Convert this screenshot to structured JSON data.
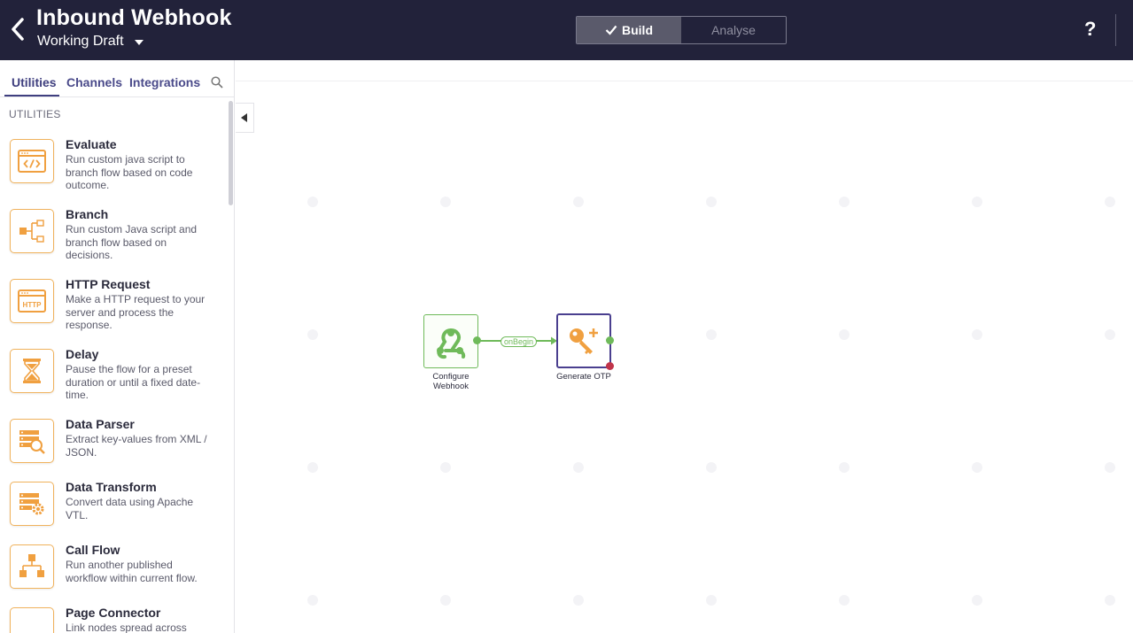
{
  "header": {
    "title": "Inbound Webhook",
    "draft_label": "Working Draft",
    "mode_build": "Build",
    "mode_analyse": "Analyse",
    "help": "?"
  },
  "sidebar": {
    "tabs": [
      "Utilities",
      "Channels",
      "Integrations"
    ],
    "active_tab": "Utilities",
    "section_label": "UTILITIES",
    "items": [
      {
        "name": "Evaluate",
        "desc": "Run custom java script to branch flow based on code outcome.",
        "icon": "code-window-icon"
      },
      {
        "name": "Branch",
        "desc": "Run custom Java script and branch flow based on decisions.",
        "icon": "branch-icon"
      },
      {
        "name": "HTTP Request",
        "desc": "Make a HTTP request to your server and process the response.",
        "icon": "http-window-icon"
      },
      {
        "name": "Delay",
        "desc": "Pause the flow for a preset duration or until a fixed date-time.",
        "icon": "hourglass-icon"
      },
      {
        "name": "Data Parser",
        "desc": "Extract key-values from XML / JSON.",
        "icon": "data-parser-icon"
      },
      {
        "name": "Data Transform",
        "desc": "Convert data using Apache VTL.",
        "icon": "data-transform-icon"
      },
      {
        "name": "Call Flow",
        "desc": "Run another published workflow within current flow.",
        "icon": "call-flow-icon"
      },
      {
        "name": "Page Connector",
        "desc": "Link nodes spread across",
        "icon": "page-connector-icon"
      }
    ]
  },
  "canvas": {
    "nodes": [
      {
        "label": "Configure Webhook",
        "icon": "webhook-icon",
        "color": "#6fba5a"
      },
      {
        "label": "Generate OTP",
        "icon": "key-plus-icon",
        "color": "#4a3f8f"
      }
    ],
    "edge_label": "onBegin"
  },
  "colors": {
    "header_bg": "#22223a",
    "accent_orange": "#f0a040",
    "success_green": "#6fba5a",
    "selected_purple": "#4a3f8f",
    "error_red": "#c0344a"
  }
}
